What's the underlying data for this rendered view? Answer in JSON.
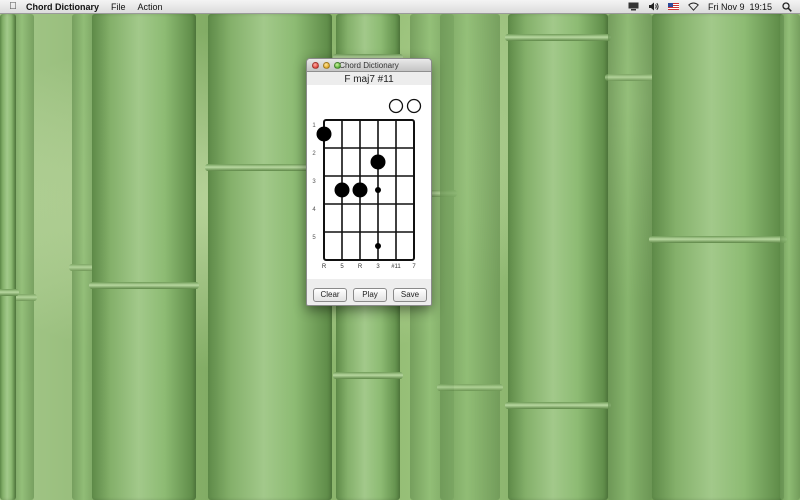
{
  "menubar": {
    "apple_icon": "apple-logo-icon",
    "app_name": "Chord Dictionary",
    "menus": [
      "File",
      "Action"
    ],
    "status_icons": [
      "display-icon",
      "volume-icon",
      "us-flag-icon",
      "wifi-icon"
    ],
    "clock": "Fri Nov 9  19:15",
    "spotlight_icon": "spotlight-search-icon"
  },
  "window": {
    "title": "Chord Dictionary",
    "chord_name": "F maj7 #11",
    "fret_numbers": [
      "1",
      "2",
      "3",
      "4",
      "5"
    ],
    "string_labels": [
      "R",
      "5",
      "R",
      "3",
      "#11",
      "7"
    ],
    "open_strings": [
      "string-5",
      "string-6"
    ],
    "finger_positions": [
      {
        "string": 1,
        "fret": 1,
        "size": "large"
      },
      {
        "string": 2,
        "fret": 3,
        "size": "large"
      },
      {
        "string": 3,
        "fret": 3,
        "size": "large"
      },
      {
        "string": 4,
        "fret": 2,
        "size": "large"
      },
      {
        "string": 4,
        "fret": 3,
        "size": "small"
      },
      {
        "string": 4,
        "fret": 5,
        "size": "small"
      }
    ],
    "buttons": {
      "clear": "Clear",
      "play": "Play",
      "save": "Save"
    }
  },
  "colors": {
    "wallpaper_accent": "#84b06a",
    "close": "#e0443a",
    "minimize": "#e0a825",
    "zoom": "#58b23a"
  }
}
